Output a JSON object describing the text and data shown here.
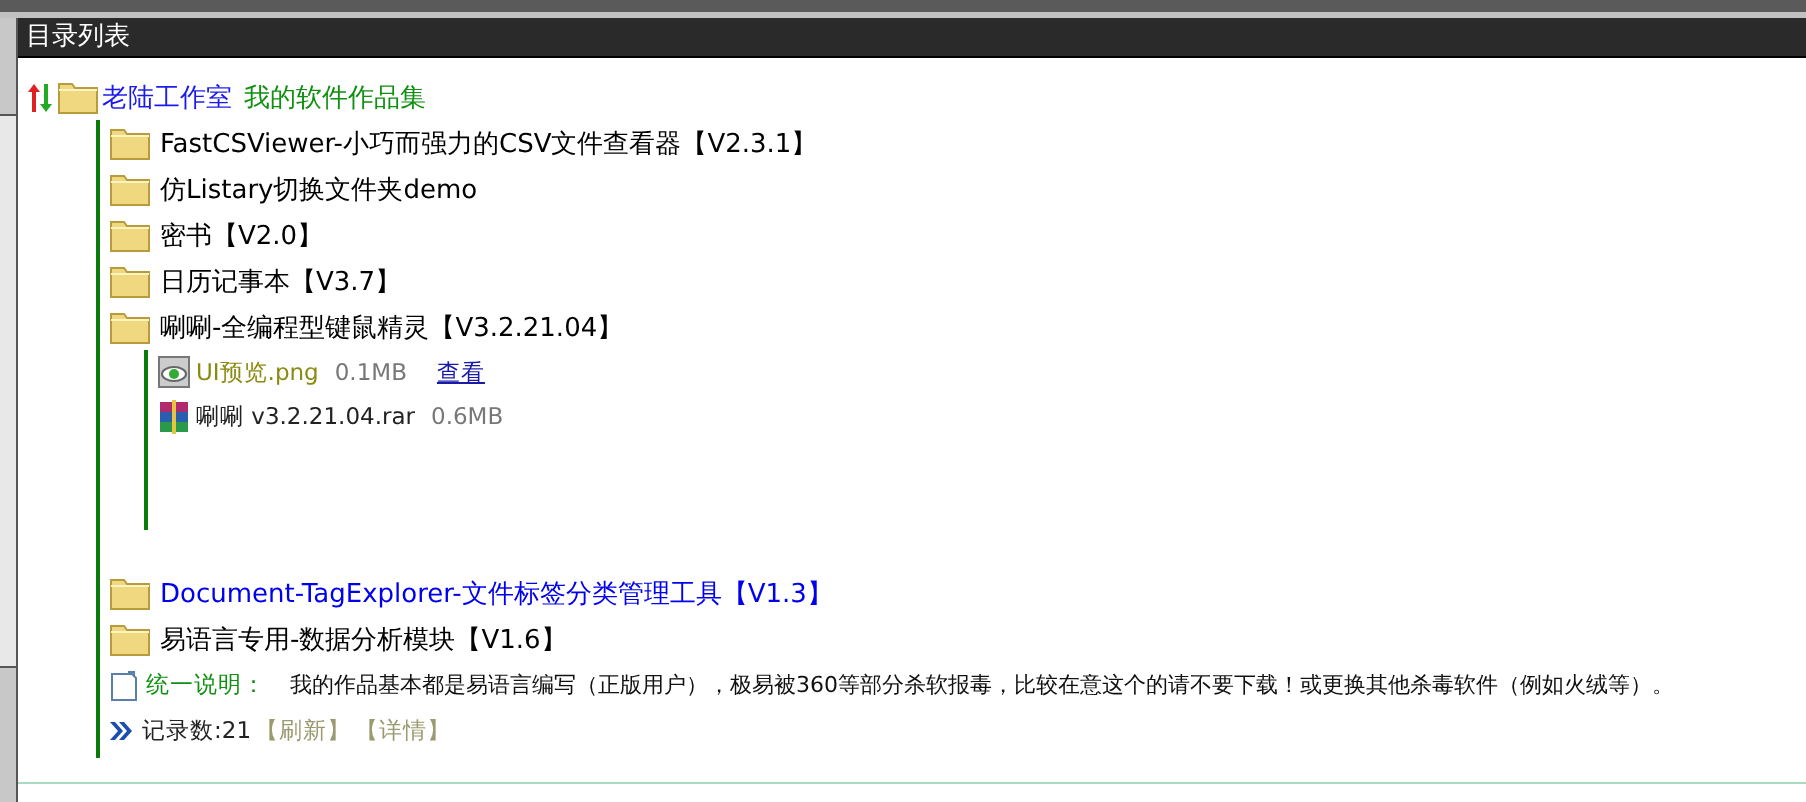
{
  "panel": {
    "title": "目录列表"
  },
  "root": {
    "name": "老陆工作室",
    "subtitle": "我的软件作品集",
    "children": [
      {
        "name": "FastCSViewer-小巧而强力的CSV文件查看器【V2.3.1】",
        "color": "#000000"
      },
      {
        "name": "仿Listary切换文件夹demo",
        "color": "#000000"
      },
      {
        "name": "密书【V2.0】",
        "color": "#000000"
      },
      {
        "name": "日历记事本【V3.7】",
        "color": "#000000"
      },
      {
        "name": "唰唰-全编程型键鼠精灵【V3.2.21.04】",
        "color": "#000000",
        "files": [
          {
            "kind": "image",
            "name": "UI预览.png",
            "size": "0.1MB",
            "link": "查看"
          },
          {
            "kind": "archive",
            "name": "唰唰 v3.2.21.04.rar",
            "size": "0.6MB"
          }
        ]
      },
      {
        "name": "Document-TagExplorer-文件标签分类管理工具【V1.3】",
        "color": "#0000ee"
      },
      {
        "name": "易语言专用-数据分析模块【V1.6】",
        "color": "#000000"
      }
    ],
    "note": {
      "label": "统一说明：",
      "text": "我的作品基本都是易语言编写（正版用户），极易被360等部分杀软报毒，比较在意这个的请不要下载！或更换其他杀毒软件（例如火绒等）。"
    },
    "footer": {
      "count": "记录数:21",
      "actions": [
        "【刷新】",
        "【详情】"
      ]
    }
  }
}
